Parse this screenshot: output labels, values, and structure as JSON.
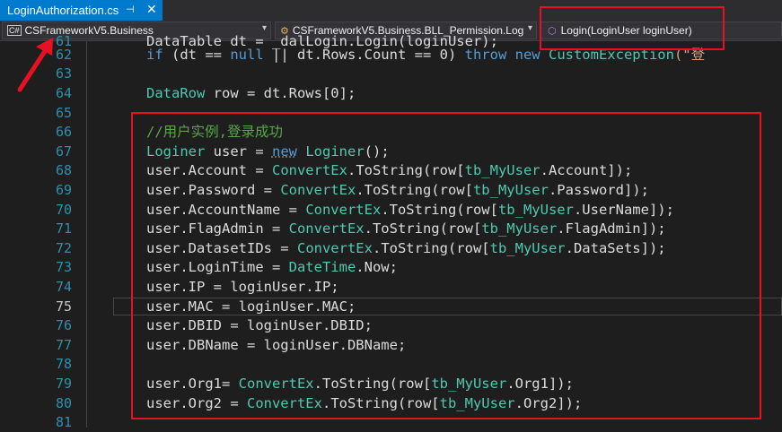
{
  "tab": {
    "title": "LoginAuthorization.cs",
    "pin": "⊣",
    "close": "✕"
  },
  "navbar": {
    "project_badge": "C#",
    "project": "CSFrameworkV5.Business",
    "class_name": "CSFrameworkV5.Business.BLL_Permission.Log",
    "method": "Login(LoginUser loginUser)"
  },
  "line_numbers": [
    "61",
    "62",
    "63",
    "64",
    "65",
    "66",
    "67",
    "68",
    "69",
    "70",
    "71",
    "72",
    "73",
    "74",
    "75",
    "76",
    "77",
    "78",
    "79",
    "80",
    "81"
  ],
  "current_line": "75",
  "code": {
    "l61": "DataTable dt = _dalLogin.Login(loginUser);",
    "l62_a": "if",
    "l62_b": " (dt == ",
    "l62_c": "null",
    "l62_d": " || dt.Rows.Count == 0) ",
    "l62_e": "throw",
    "l62_f": " ",
    "l62_g": "new",
    "l62_h": " ",
    "l62_i": "CustomException",
    "l62_j": "(\"登",
    "l64_a": "DataRow",
    "l64_b": " row = dt.Rows[0];",
    "l66": "//用户实例,登录成功",
    "l67_a": "Loginer",
    "l67_b": " user = ",
    "l67_c": "new",
    "l67_d": " ",
    "l67_e": "Loginer",
    "l67_f": "();",
    "l68_a": "user.Account = ",
    "l68_b": "ConvertEx",
    "l68_c": ".ToString(row[",
    "l68_d": "tb_MyUser",
    "l68_e": ".Account]);",
    "l69_a": "user.Password = ",
    "l69_b": "ConvertEx",
    "l69_c": ".ToString(row[",
    "l69_d": "tb_MyUser",
    "l69_e": ".Password]);",
    "l70_a": "user.AccountName = ",
    "l70_b": "ConvertEx",
    "l70_c": ".ToString(row[",
    "l70_d": "tb_MyUser",
    "l70_e": ".UserName]);",
    "l71_a": "user.FlagAdmin = ",
    "l71_b": "ConvertEx",
    "l71_c": ".ToString(row[",
    "l71_d": "tb_MyUser",
    "l71_e": ".FlagAdmin]);",
    "l72_a": "user.DatasetIDs = ",
    "l72_b": "ConvertEx",
    "l72_c": ".ToString(row[",
    "l72_d": "tb_MyUser",
    "l72_e": ".DataSets]);",
    "l73_a": "user.LoginTime = ",
    "l73_b": "DateTime",
    "l73_c": ".Now;",
    "l74": "user.IP = loginUser.IP;",
    "l75": "user.MAC = loginUser.MAC;",
    "l76": "user.DBID = loginUser.DBID;",
    "l77": "user.DBName = loginUser.DBName;",
    "l79_a": "user.Org1= ",
    "l79_b": "ConvertEx",
    "l79_c": ".ToString(row[",
    "l79_d": "tb_MyUser",
    "l79_e": ".Org1]);",
    "l80_a": "user.Org2 = ",
    "l80_b": "ConvertEx",
    "l80_c": ".ToString(row[",
    "l80_d": "tb_MyUser",
    "l80_e": ".Org2]);"
  },
  "colors": {
    "keyword": "#569cd6",
    "type": "#4ec9b0",
    "comment": "#57a64a",
    "string": "#d69d85",
    "annotation": "#e81123",
    "tab_active": "#007acc"
  }
}
